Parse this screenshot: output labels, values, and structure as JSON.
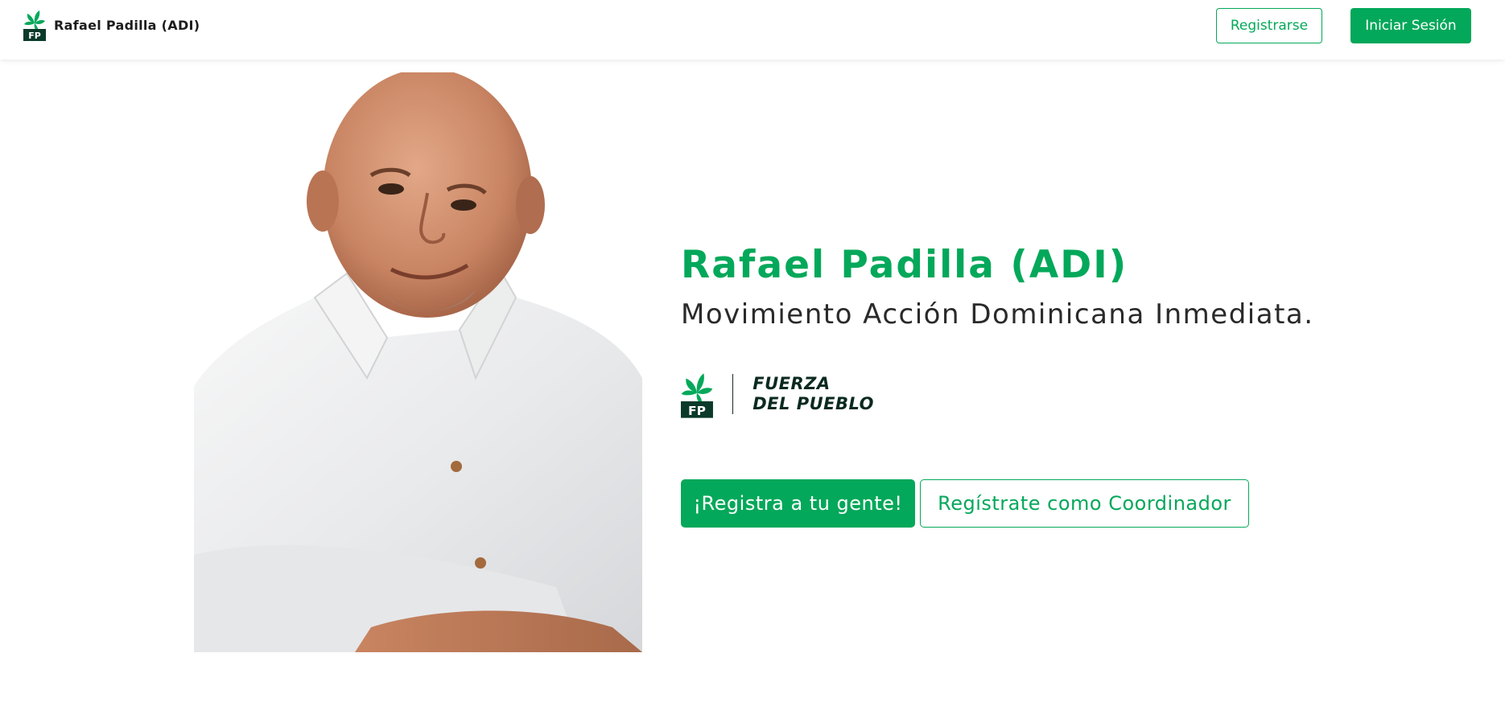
{
  "navbar": {
    "brand_name": "Rafael Padilla (ADI)",
    "brand_logo_icon": "fp-flower-logo-icon",
    "register_label": "Registrarse",
    "login_label": "Iniciar Sesión"
  },
  "hero": {
    "title": "Rafael Padilla (ADI)",
    "subtitle": "Movimiento Acción Dominicana Inmediata.",
    "portrait": "man-in-white-shirt-portrait",
    "party_logo": {
      "emblem_text": "FP",
      "name_line1": "FUERZA",
      "name_line2": "DEL PUEBLO"
    },
    "cta_primary": "¡Registra a tu gente!",
    "cta_secondary": "Regístrate como Coordinador"
  },
  "colors": {
    "accent": "#04a85a",
    "text_dark": "#2a2a2a",
    "emblem_dark": "#0b3a2a"
  }
}
